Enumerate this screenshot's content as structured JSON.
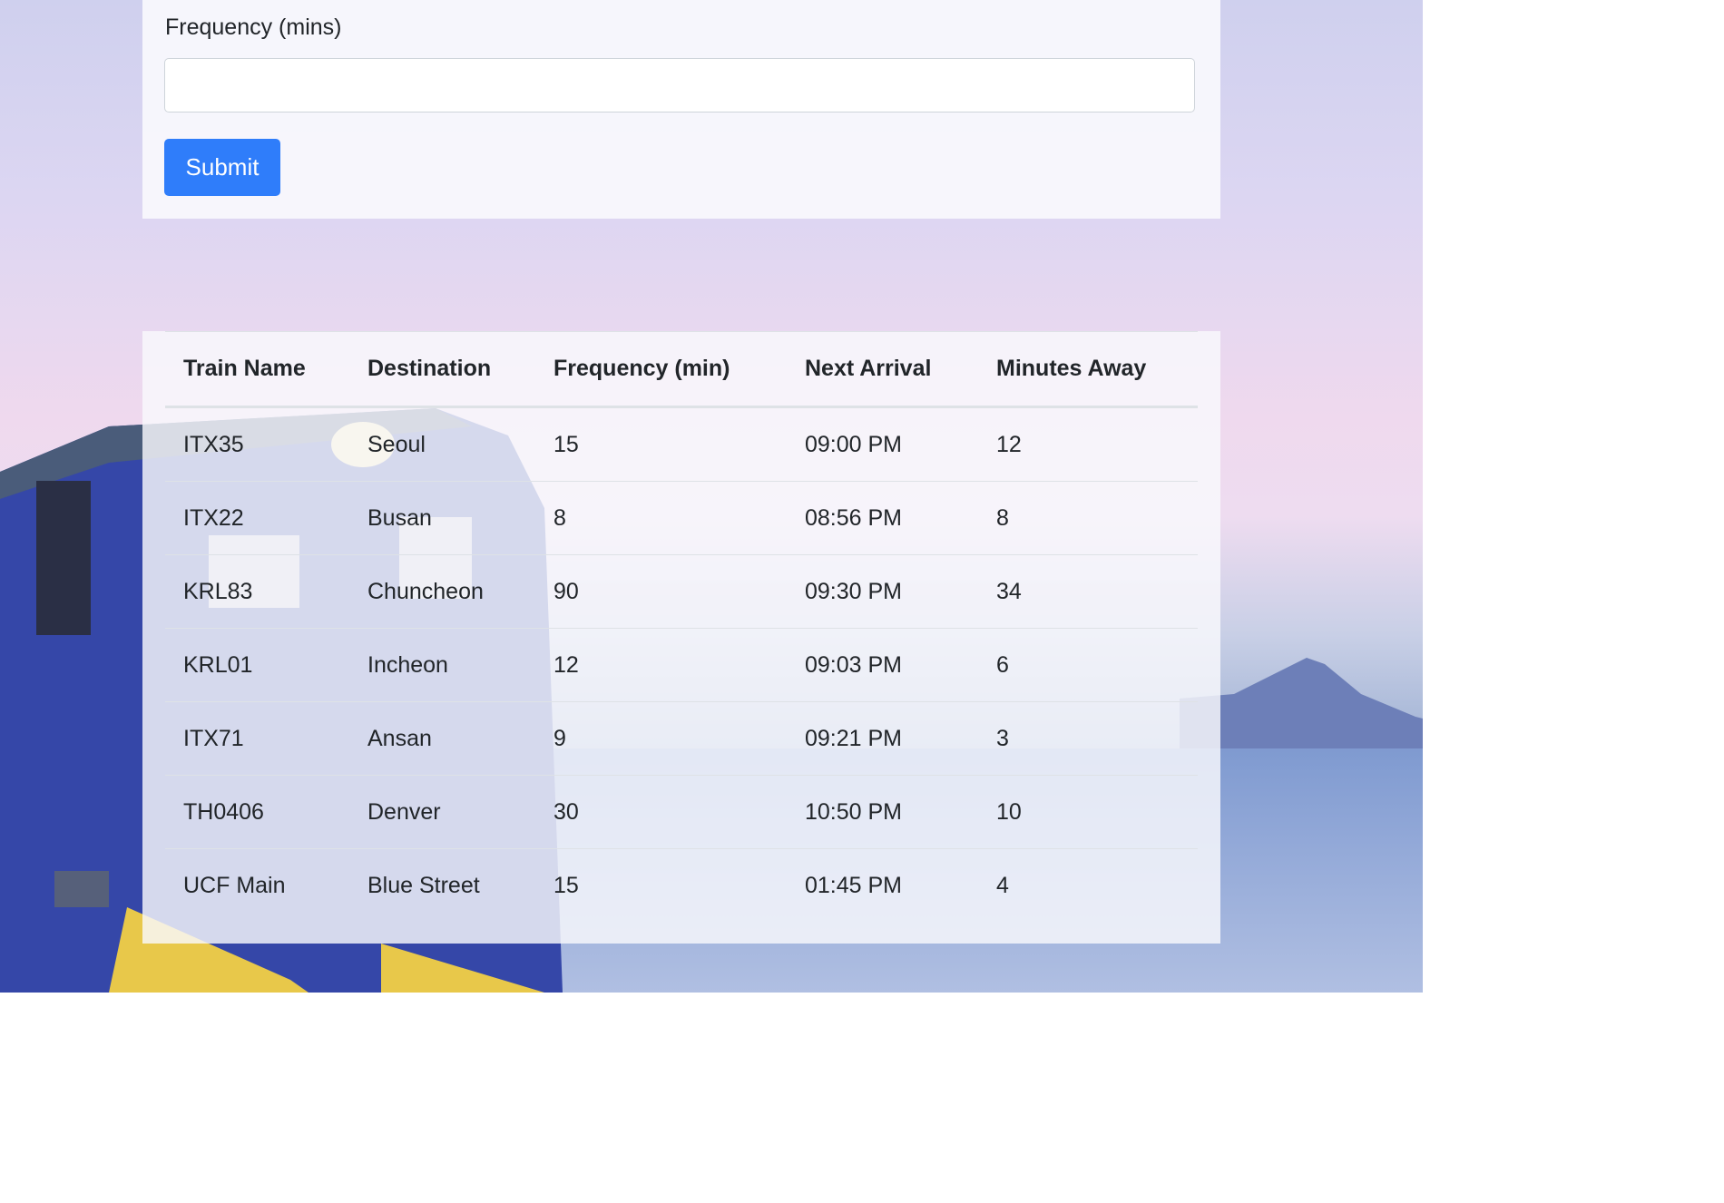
{
  "form": {
    "frequency_label": "Frequency (mins)",
    "frequency_value": "",
    "submit_label": "Submit"
  },
  "table": {
    "headers": [
      "Train Name",
      "Destination",
      "Frequency (min)",
      "Next Arrival",
      "Minutes Away"
    ],
    "rows": [
      [
        "ITX35",
        "Seoul",
        "15",
        "09:00 PM",
        "12"
      ],
      [
        "ITX22",
        "Busan",
        "8",
        "08:56 PM",
        "8"
      ],
      [
        "KRL83",
        "Chuncheon",
        "90",
        "09:30 PM",
        "34"
      ],
      [
        "KRL01",
        "Incheon",
        "12",
        "09:03 PM",
        "6"
      ],
      [
        "ITX71",
        "Ansan",
        "9",
        "09:21 PM",
        "3"
      ],
      [
        "TH0406",
        "Denver",
        "30",
        "10:50 PM",
        "10"
      ],
      [
        "UCF Main",
        "Blue Street",
        "15",
        "01:45 PM",
        "4"
      ]
    ]
  },
  "colors": {
    "submit_button": "#2f7dfa",
    "row_divider": "#dee2e6"
  }
}
